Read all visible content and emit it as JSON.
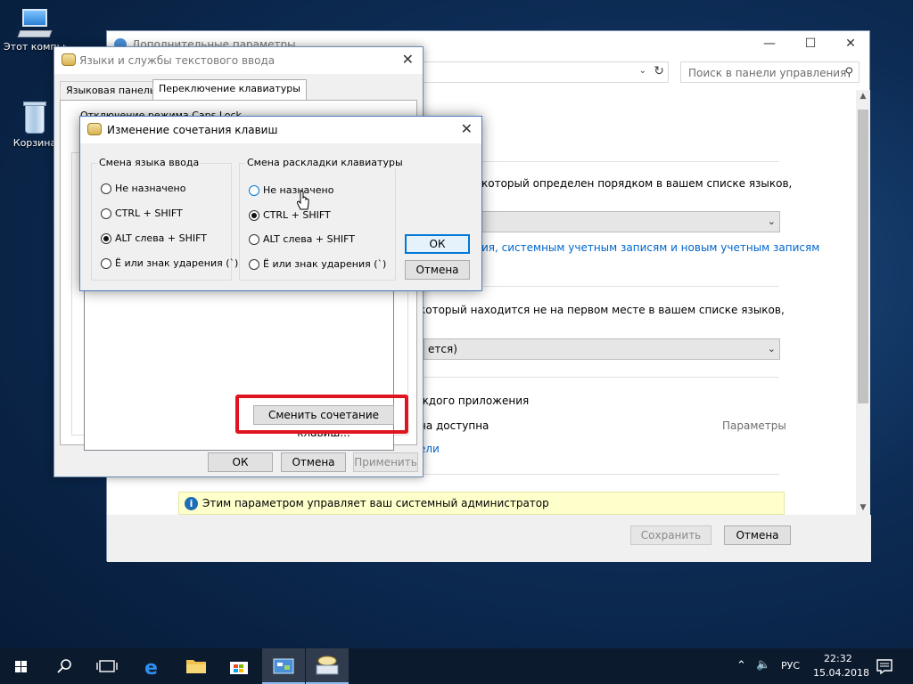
{
  "desktop": {
    "icons": [
      {
        "label": "Этот компьютер"
      },
      {
        "label": "Корзина"
      }
    ]
  },
  "control_panel": {
    "title": "Дополнительные параметры",
    "search_placeholder": "Поиск в панели управления",
    "line1": "который определен порядком в вашем списке языков,",
    "select1_value": "",
    "link1": "ия, системным учетным записям и новым учетным записям",
    "line2": "который находится не на первом месте в вашем списке языков,",
    "select2_value": "ется)",
    "line3": "ждого приложения",
    "line4": "на доступна",
    "params_link": "Параметры",
    "link2": "ели",
    "info_text": "Этим параметром управляет ваш системный администратор",
    "save_label": "Сохранить",
    "cancel_label": "Отмена"
  },
  "text_services": {
    "title": "Языки и службы текстового ввода",
    "tabs": [
      {
        "label": "Языковая панель"
      },
      {
        "label": "Переключение клавиатуры"
      }
    ],
    "caps_lock_label": "Отключение режима Caps Lock",
    "change_shortcut_label": "Сменить сочетание клавиш...",
    "ok_label": "ОК",
    "cancel_label": "Отмена",
    "apply_label": "Применить"
  },
  "shortcut_dialog": {
    "title": "Изменение сочетания клавиш",
    "input_lang_group": {
      "legend": "Смена языка ввода",
      "options": [
        {
          "label": "Не назначено",
          "selected": false
        },
        {
          "label": "CTRL + SHIFT",
          "selected": false
        },
        {
          "label": "ALT слева + SHIFT",
          "selected": true
        },
        {
          "label": "Ё или знак ударения (`)",
          "selected": false
        }
      ]
    },
    "layout_group": {
      "legend": "Смена раскладки клавиатуры",
      "options": [
        {
          "label": "Не назначено",
          "selected": false
        },
        {
          "label": "CTRL + SHIFT",
          "selected": true
        },
        {
          "label": "ALT слева + SHIFT",
          "selected": false
        },
        {
          "label": "Ё или знак ударения (`)",
          "selected": false
        }
      ]
    },
    "ok_label": "ОК",
    "cancel_label": "Отмена"
  },
  "taskbar": {
    "lang": "РУС",
    "time": "22:32",
    "date": "15.04.2018"
  }
}
